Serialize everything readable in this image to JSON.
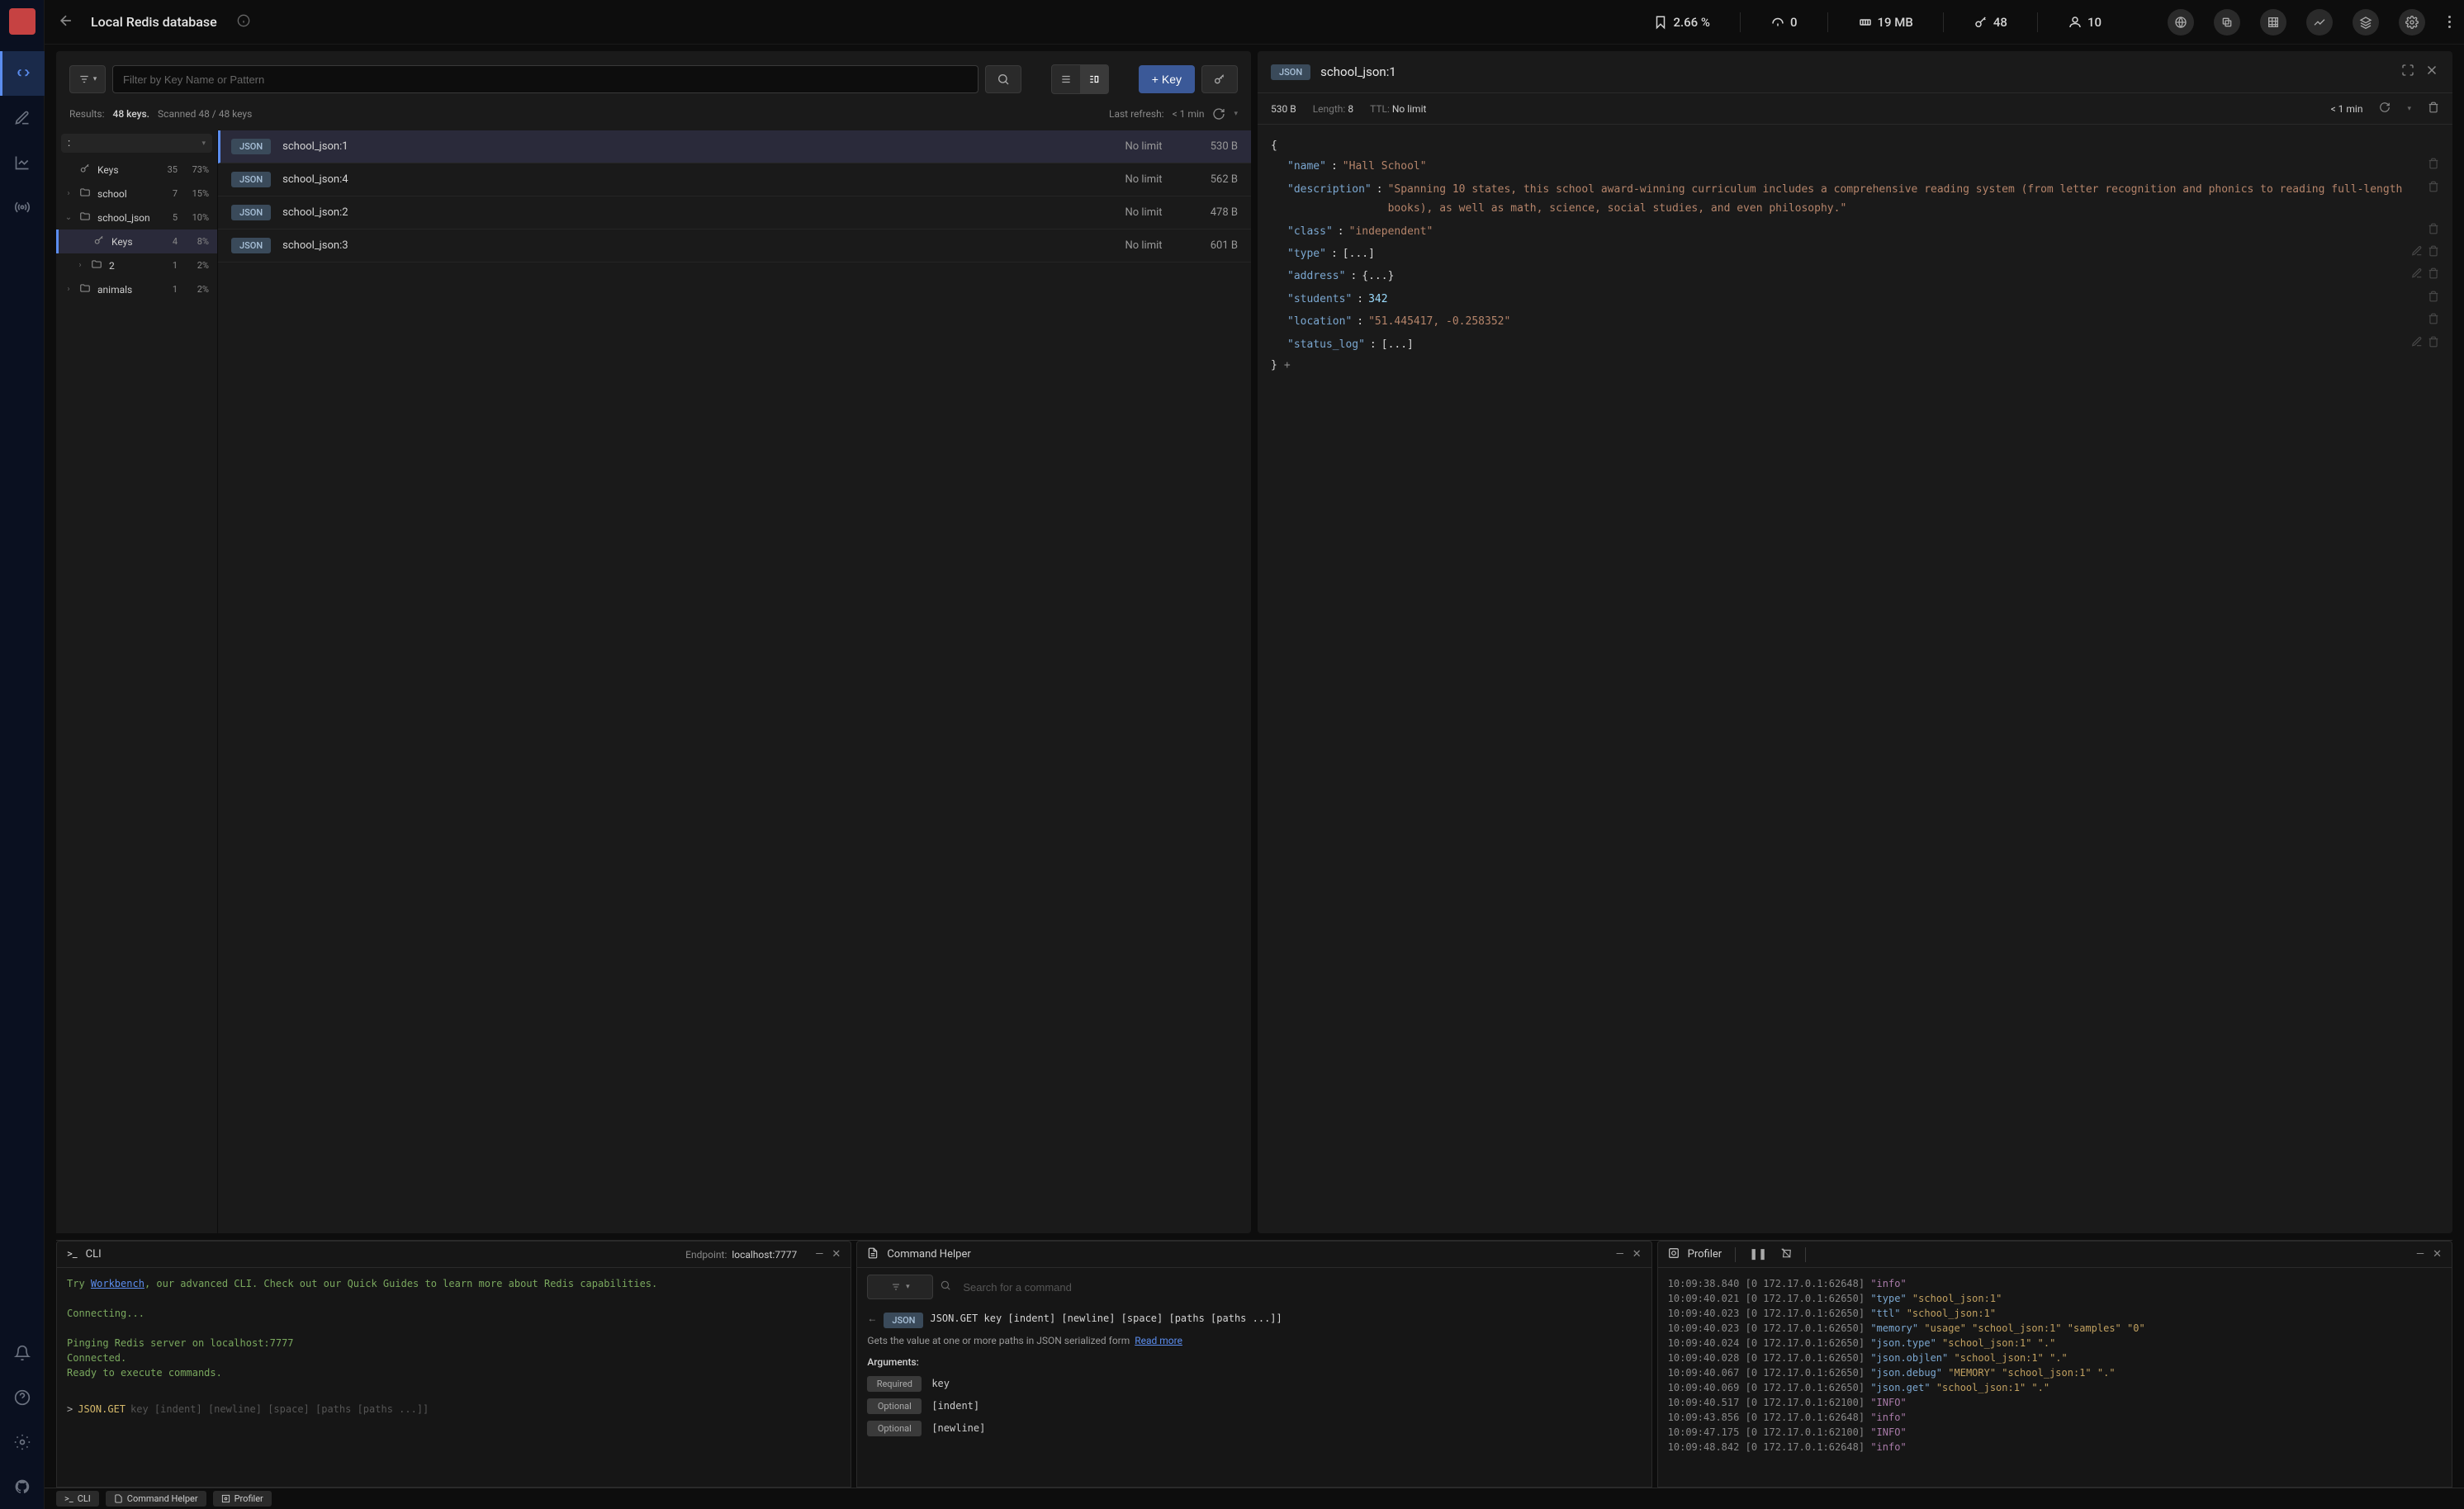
{
  "header": {
    "db_name": "Local Redis database",
    "stats": {
      "cpu": "2.66 %",
      "commands": "0",
      "memory": "19 MB",
      "keys": "48",
      "clients": "10"
    }
  },
  "browser": {
    "search_placeholder": "Filter by Key Name or Pattern",
    "add_key_label": "+ Key",
    "results_prefix": "Results:",
    "results_count": "48 keys.",
    "scanned": "Scanned 48 / 48 keys",
    "last_refresh_label": "Last refresh:",
    "last_refresh_value": "< 1 min"
  },
  "tree": {
    "delimiter": ":",
    "items": [
      {
        "type": "keys",
        "label": "Keys",
        "count": "35",
        "pct": "73%",
        "indent": 0,
        "expand": ""
      },
      {
        "type": "folder",
        "label": "school",
        "count": "7",
        "pct": "15%",
        "indent": 0,
        "expand": "›"
      },
      {
        "type": "folder",
        "label": "school_json",
        "count": "5",
        "pct": "10%",
        "indent": 0,
        "expand": "⌄",
        "open": true
      },
      {
        "type": "keys",
        "label": "Keys",
        "count": "4",
        "pct": "8%",
        "indent": 1,
        "expand": "",
        "selected": true
      },
      {
        "type": "folder",
        "label": "2",
        "count": "1",
        "pct": "2%",
        "indent": 1,
        "expand": "›"
      },
      {
        "type": "folder",
        "label": "animals",
        "count": "1",
        "pct": "2%",
        "indent": 0,
        "expand": "›"
      }
    ]
  },
  "keys": [
    {
      "type": "JSON",
      "name": "school_json:1",
      "ttl": "No limit",
      "size": "530 B",
      "selected": true
    },
    {
      "type": "JSON",
      "name": "school_json:4",
      "ttl": "No limit",
      "size": "562 B"
    },
    {
      "type": "JSON",
      "name": "school_json:2",
      "ttl": "No limit",
      "size": "478 B"
    },
    {
      "type": "JSON",
      "name": "school_json:3",
      "ttl": "No limit",
      "size": "601 B"
    }
  ],
  "details": {
    "type_badge": "JSON",
    "name": "school_json:1",
    "size": "530 B",
    "length_label": "Length:",
    "length": "8",
    "ttl_label": "TTL:",
    "ttl": "No limit",
    "refresh": "< 1 min",
    "json": {
      "open": "{",
      "rows": [
        {
          "key": "\"name\"",
          "val": "\"Hall School\"",
          "type": "str"
        },
        {
          "key": "\"description\"",
          "val": "\"Spanning 10 states, this school award-winning curriculum includes a comprehensive reading system (from letter recognition and phonics to reading full-length books), as well as math, science, social studies, and even philosophy.\"",
          "type": "str"
        },
        {
          "key": "\"class\"",
          "val": "\"independent\"",
          "type": "str"
        },
        {
          "key": "\"type\"",
          "val": "[...]",
          "type": "obj",
          "editable": true
        },
        {
          "key": "\"address\"",
          "val": "{...}",
          "type": "obj",
          "editable": true
        },
        {
          "key": "\"students\"",
          "val": "342",
          "type": "num"
        },
        {
          "key": "\"location\"",
          "val": "\"51.445417, -0.258352\"",
          "type": "str"
        },
        {
          "key": "\"status_log\"",
          "val": "[...]",
          "type": "obj",
          "editable": true
        }
      ],
      "close": "}"
    }
  },
  "cli": {
    "title": "CLI",
    "endpoint_label": "Endpoint:",
    "endpoint": "localhost:7777",
    "lines": {
      "l1a": "Try ",
      "l1link": "Workbench",
      "l1b": ", our advanced CLI. Check out our Quick Guides to learn more about Redis capabilities.",
      "l2": "Connecting...",
      "l3": "Pinging Redis server on localhost:7777",
      "l4": "Connected.",
      "l5": "Ready to execute commands."
    },
    "prompt": {
      "sym": ">",
      "cmd": "JSON.GET",
      "args": "key [indent] [newline] [space] [paths [paths ...]]"
    }
  },
  "helper": {
    "title": "Command Helper",
    "search_placeholder": "Search for a command",
    "badge": "JSON",
    "cmd": "JSON.GET key [indent] [newline] [space] [paths [paths ...]]",
    "desc": "Gets the value at one or more paths in JSON serialized form",
    "read_more": "Read more",
    "args_title": "Arguments:",
    "args": [
      {
        "badge": "Required",
        "name": "key"
      },
      {
        "badge": "Optional",
        "name": "[indent]"
      },
      {
        "badge": "Optional",
        "name": "[newline]"
      }
    ]
  },
  "profiler": {
    "title": "Profiler",
    "lines": [
      {
        "t": "10:09:38.840",
        "a": "[0 172.17.0.1:62648]",
        "c": "\"info\"",
        "r": ""
      },
      {
        "t": "10:09:40.021",
        "a": "[0 172.17.0.1:62650]",
        "c": "\"type\"",
        "r": "\"school_json:1\""
      },
      {
        "t": "10:09:40.023",
        "a": "[0 172.17.0.1:62650]",
        "c": "\"ttl\"",
        "r": "\"school_json:1\""
      },
      {
        "t": "10:09:40.023",
        "a": "[0 172.17.0.1:62650]",
        "c": "\"memory\"",
        "r": "\"usage\" \"school_json:1\" \"samples\" \"0\""
      },
      {
        "t": "10:09:40.024",
        "a": "[0 172.17.0.1:62650]",
        "c": "\"json.type\"",
        "r": "\"school_json:1\" \".\""
      },
      {
        "t": "10:09:40.028",
        "a": "[0 172.17.0.1:62650]",
        "c": "\"json.objlen\"",
        "r": "\"school_json:1\" \".\""
      },
      {
        "t": "10:09:40.067",
        "a": "[0 172.17.0.1:62650]",
        "c": "\"json.debug\"",
        "r": "\"MEMORY\" \"school_json:1\" \".\""
      },
      {
        "t": "10:09:40.069",
        "a": "[0 172.17.0.1:62650]",
        "c": "\"json.get\"",
        "r": "\"school_json:1\" \".\""
      },
      {
        "t": "10:09:40.517",
        "a": "[0 172.17.0.1:62100]",
        "c": "\"INFO\"",
        "r": ""
      },
      {
        "t": "10:09:43.856",
        "a": "[0 172.17.0.1:62648]",
        "c": "\"info\"",
        "r": ""
      },
      {
        "t": "10:09:47.175",
        "a": "[0 172.17.0.1:62100]",
        "c": "\"INFO\"",
        "r": ""
      },
      {
        "t": "10:09:48.842",
        "a": "[0 172.17.0.1:62648]",
        "c": "\"info\"",
        "r": ""
      }
    ]
  },
  "footer_tabs": {
    "cli": "CLI",
    "helper": "Command Helper",
    "profiler": "Profiler"
  }
}
